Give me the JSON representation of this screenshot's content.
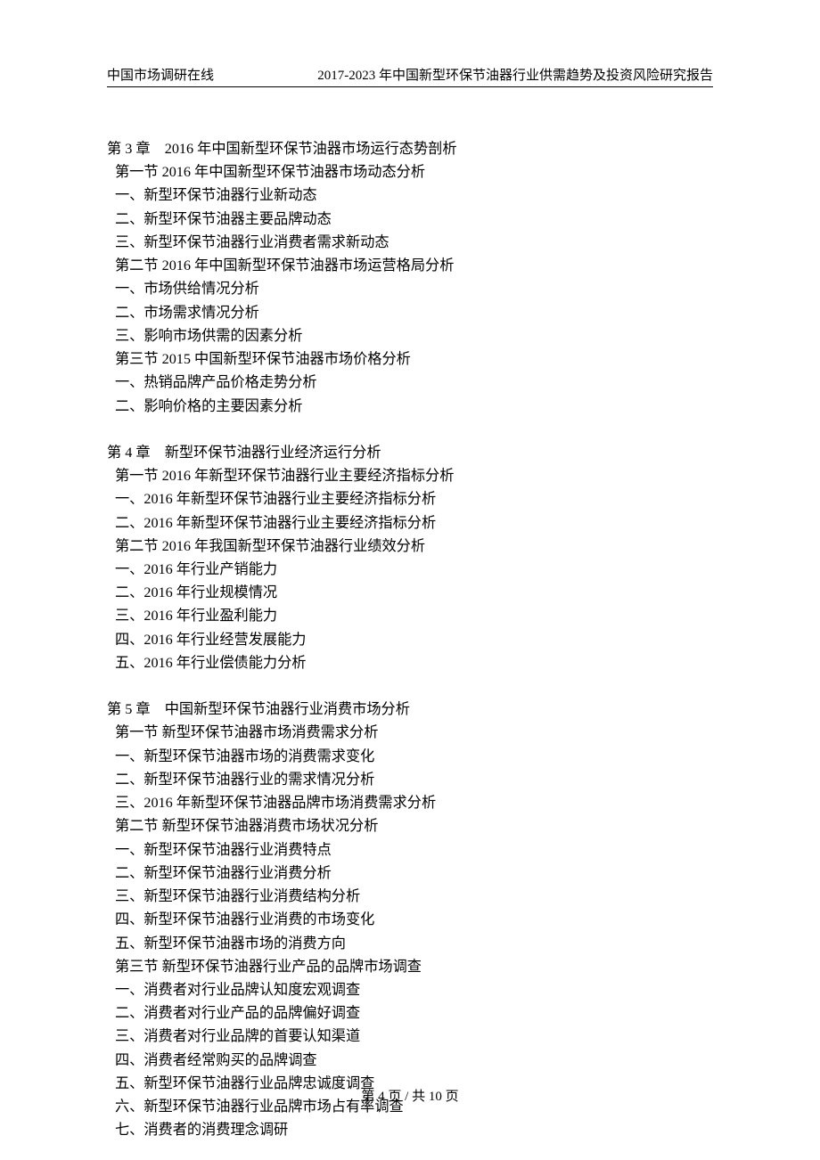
{
  "header": {
    "left": "中国市场调研在线",
    "right": "2017-2023 年中国新型环保节油器行业供需趋势及投资风险研究报告"
  },
  "chapters": [
    {
      "title": "第 3 章　2016 年中国新型环保节油器市场运行态势剖析",
      "lines": [
        "第一节 2016 年中国新型环保节油器市场动态分析",
        "一、新型环保节油器行业新动态",
        "二、新型环保节油器主要品牌动态",
        "三、新型环保节油器行业消费者需求新动态",
        "第二节 2016 年中国新型环保节油器市场运营格局分析",
        "一、市场供给情况分析",
        "二、市场需求情况分析",
        "三、影响市场供需的因素分析",
        "第三节 2015  中国新型环保节油器市场价格分析",
        "一、热销品牌产品价格走势分析",
        "二、影响价格的主要因素分析"
      ]
    },
    {
      "title": "第 4 章　新型环保节油器行业经济运行分析",
      "lines": [
        "第一节 2016 年新型环保节油器行业主要经济指标分析",
        "一、2016 年新型环保节油器行业主要经济指标分析",
        "二、2016 年新型环保节油器行业主要经济指标分析",
        "第二节 2016 年我国新型环保节油器行业绩效分析",
        "一、2016 年行业产销能力",
        "二、2016 年行业规模情况",
        "三、2016 年行业盈利能力",
        "四、2016 年行业经营发展能力",
        "五、2016 年行业偿债能力分析"
      ]
    },
    {
      "title": "第 5 章　中国新型环保节油器行业消费市场分析",
      "lines": [
        "第一节  新型环保节油器市场消费需求分析",
        "一、新型环保节油器市场的消费需求变化",
        "二、新型环保节油器行业的需求情况分析",
        "三、2016 年新型环保节油器品牌市场消费需求分析",
        "第二节  新型环保节油器消费市场状况分析",
        "一、新型环保节油器行业消费特点",
        "二、新型环保节油器行业消费分析",
        "三、新型环保节油器行业消费结构分析",
        "四、新型环保节油器行业消费的市场变化",
        "五、新型环保节油器市场的消费方向",
        "第三节  新型环保节油器行业产品的品牌市场调查",
        "一、消费者对行业品牌认知度宏观调查",
        "二、消费者对行业产品的品牌偏好调查",
        "三、消费者对行业品牌的首要认知渠道",
        "四、消费者经常购买的品牌调查",
        "五、新型环保节油器行业品牌忠诚度调查",
        "六、新型环保节油器行业品牌市场占有率调查",
        "七、消费者的消费理念调研"
      ]
    }
  ],
  "footer": {
    "text": "第 4 页 / 共 10 页"
  }
}
